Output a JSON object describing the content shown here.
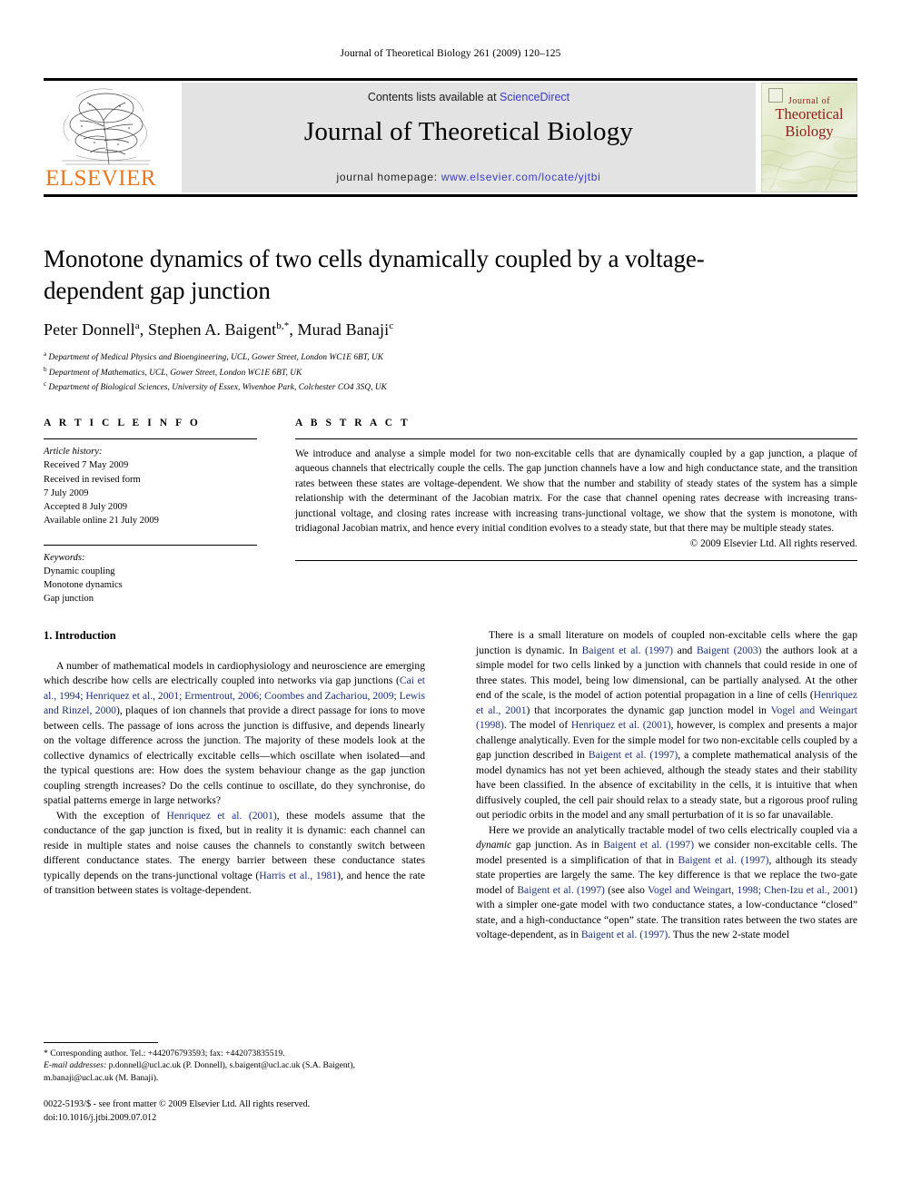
{
  "running_head": "Journal of Theoretical Biology 261 (2009) 120–125",
  "masthead": {
    "contents_prefix": "Contents lists available at ",
    "sciencedirect": "ScienceDirect",
    "journal_title": "Journal of Theoretical Biology",
    "homepage_prefix": "journal homepage: ",
    "homepage_url": "www.elsevier.com/locate/yjtbi",
    "publisher_wordmark": "ELSEVIER",
    "publisher_color": "#E87722",
    "link_color": "#3b3bbf",
    "cover": {
      "line1": "Journal of",
      "line2": "Theoretical",
      "line3": "Biology",
      "title_color": "#8e1b1b"
    }
  },
  "article": {
    "title": "Monotone dynamics of two cells dynamically coupled by a voltage-dependent gap junction",
    "authors_html": "Peter Donnell<sup>a</sup>, Stephen A. Baigent<sup>b,*</sup>, Murad Banaji<sup>c</sup>",
    "affiliations": [
      {
        "mark": "a",
        "text": "Department of Medical Physics and Bioengineering, UCL, Gower Street, London WC1E 6BT, UK"
      },
      {
        "mark": "b",
        "text": "Department of Mathematics, UCL, Gower Street, London WC1E 6BT, UK"
      },
      {
        "mark": "c",
        "text": "Department of Biological Sciences, University of Essex, Wivenhoe Park, Colchester CO4 3SQ, UK"
      }
    ]
  },
  "article_info": {
    "heading": "A R T I C L E    I N F O",
    "history_label": "Article history:",
    "history": [
      "Received 7 May 2009",
      "Received in revised form",
      "7 July 2009",
      "Accepted 8 July 2009",
      "Available online 21 July 2009"
    ],
    "keywords_label": "Keywords:",
    "keywords": [
      "Dynamic coupling",
      "Monotone dynamics",
      "Gap junction"
    ]
  },
  "abstract": {
    "heading": "A B S T R A C T",
    "text": "We introduce and analyse a simple model for two non-excitable cells that are dynamically coupled by a gap junction, a plaque of aqueous channels that electrically couple the cells. The gap junction channels have a low and high conductance state, and the transition rates between these states are voltage-dependent. We show that the number and stability of steady states of the system has a simple relationship with the determinant of the Jacobian matrix. For the case that channel opening rates decrease with increasing trans-junctional voltage, and closing rates increase with increasing trans-junctional voltage, we show that the system is monotone, with tridiagonal Jacobian matrix, and hence every initial condition evolves to a steady state, but that there may be multiple steady states.",
    "copyright": "© 2009 Elsevier Ltd. All rights reserved."
  },
  "body": {
    "section_number_title": "1.  Introduction",
    "left_paragraphs": [
      {
        "id": "p1",
        "runs": [
          {
            "t": "A number of mathematical models in cardiophysiology and neuroscience are emerging which describe how cells are electrically coupled into networks via gap junctions (",
            "k": "plain"
          },
          {
            "t": "Cai et al., 1994; Henriquez et al., 2001; Ermentrout, 2006; Coombes and Zachariou, 2009; Lewis and Rinzel, 2000",
            "k": "cite"
          },
          {
            "t": "), plaques of ion channels that provide a direct passage for ions to move between cells. The passage of ions across the junction is diffusive, and depends linearly on the voltage difference across the junction. The majority of these models look at the collective dynamics of electrically excitable cells—which oscillate when isolated—and the typical questions are: How does the system behaviour change as the gap junction coupling strength increases? Do the cells continue to oscillate, do they synchronise, do spatial patterns emerge in large networks?",
            "k": "plain"
          }
        ]
      },
      {
        "id": "p2",
        "runs": [
          {
            "t": "With the exception of ",
            "k": "plain"
          },
          {
            "t": "Henriquez et al. (2001)",
            "k": "cite"
          },
          {
            "t": ", these models assume that the conductance of the gap junction is fixed, but in reality it is dynamic: each channel can reside in multiple states and noise causes the channels to constantly switch between different conductance states. The energy barrier between these conductance states typically depends on the trans-junctional voltage (",
            "k": "plain"
          },
          {
            "t": "Harris et al., 1981",
            "k": "cite"
          },
          {
            "t": "), and hence the rate of transition between states is voltage-dependent.",
            "k": "plain"
          }
        ]
      }
    ],
    "right_paragraphs": [
      {
        "id": "p3",
        "runs": [
          {
            "t": "There is a small literature on models of coupled non-excitable cells where the gap junction is dynamic. In ",
            "k": "plain"
          },
          {
            "t": "Baigent et al. (1997)",
            "k": "cite"
          },
          {
            "t": " and ",
            "k": "plain"
          },
          {
            "t": "Baigent (2003)",
            "k": "cite"
          },
          {
            "t": " the authors look at a simple model for two cells linked by a junction with channels that could reside in one of three states. This model, being low dimensional, can be partially analysed. At the other end of the scale, is the model of action potential propagation in a line of cells (",
            "k": "plain"
          },
          {
            "t": "Henriquez et al., 2001",
            "k": "cite"
          },
          {
            "t": ") that incorporates the dynamic gap junction model in ",
            "k": "plain"
          },
          {
            "t": "Vogel and Weingart (1998)",
            "k": "cite"
          },
          {
            "t": ". The model of ",
            "k": "plain"
          },
          {
            "t": "Henriquez et al. (2001)",
            "k": "cite"
          },
          {
            "t": ", however, is complex and presents a major challenge analytically. Even for the simple model for two non-excitable cells coupled by a gap junction described in ",
            "k": "plain"
          },
          {
            "t": "Baigent et al. (1997)",
            "k": "cite"
          },
          {
            "t": ", a complete mathematical analysis of the model dynamics has not yet been achieved, although the steady states and their stability have been classified. In the absence of excitability in the cells, it is intuitive that when diffusively coupled, the cell pair should relax to a steady state, but a rigorous proof ruling out periodic orbits in the model and any small perturbation of it is so far unavailable.",
            "k": "plain"
          }
        ]
      },
      {
        "id": "p4",
        "runs": [
          {
            "t": "Here we provide an analytically tractable model of two cells electrically coupled via a ",
            "k": "plain"
          },
          {
            "t": "dynamic",
            "k": "ital"
          },
          {
            "t": " gap junction. As in ",
            "k": "plain"
          },
          {
            "t": "Baigent et al. (1997)",
            "k": "cite"
          },
          {
            "t": " we consider non-excitable cells. The model presented is a simplification of that in ",
            "k": "plain"
          },
          {
            "t": "Baigent et al. (1997)",
            "k": "cite"
          },
          {
            "t": ", although its steady state properties are largely the same. The key difference is that we replace the two-gate model of ",
            "k": "plain"
          },
          {
            "t": "Baigent et al. (1997)",
            "k": "cite"
          },
          {
            "t": " (see also ",
            "k": "plain"
          },
          {
            "t": "Vogel and Weingart, 1998; Chen-Izu et al., 2001",
            "k": "cite"
          },
          {
            "t": ") with a simpler one-gate model with two conductance states, a low-conductance “closed” state, and a high-conductance “open” state. The transition rates between the two states are voltage-dependent, as in ",
            "k": "plain"
          },
          {
            "t": "Baigent et al. (1997)",
            "k": "cite"
          },
          {
            "t": ". Thus the new 2-state model",
            "k": "plain"
          }
        ]
      }
    ]
  },
  "footnotes": {
    "corresponding": "* Corresponding author. Tel.: +442076793593; fax: +442073835519.",
    "email_label": "E-mail addresses:",
    "emails": "p.donnell@ucl.ac.uk (P. Donnell), s.baigent@ucl.ac.uk (S.A. Baigent), m.banaji@ucl.ac.uk (M. Banaji).",
    "issn_line": "0022-5193/$ - see front matter © 2009 Elsevier Ltd. All rights reserved.",
    "doi_line": "doi:10.1016/j.jtbi.2009.07.012"
  }
}
